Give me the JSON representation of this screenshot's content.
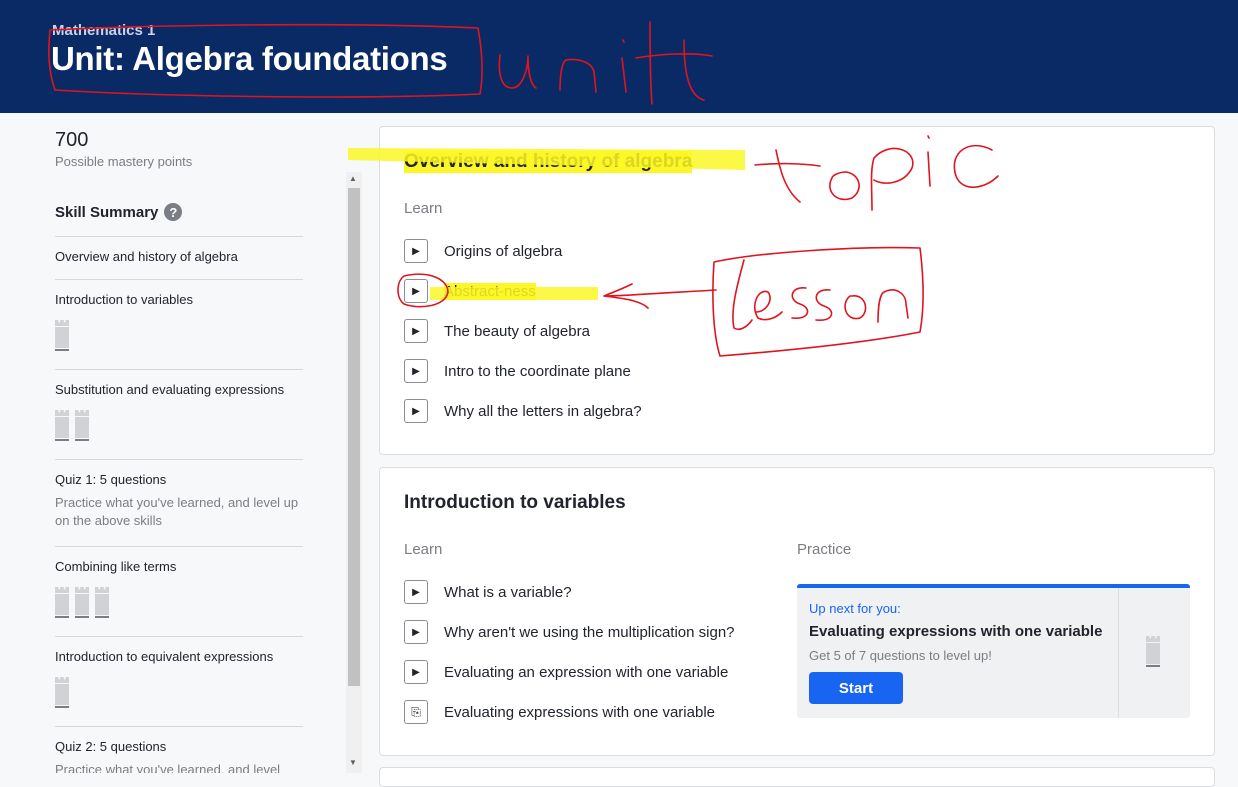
{
  "header": {
    "breadcrumb": "Mathematics 1",
    "title": "Unit: Algebra foundations"
  },
  "sidebar": {
    "points": "700",
    "points_label": "Possible mastery points",
    "skill_summary": "Skill Summary",
    "help_icon": "?",
    "items": [
      {
        "label": "Overview and history of algebra",
        "towers": 0
      },
      {
        "label": "Introduction to variables",
        "towers": 1
      },
      {
        "label": "Substitution and evaluating expressions",
        "towers": 2
      },
      {
        "label": "Quiz 1: 5 questions",
        "desc": "Practice what you've learned, and level up on the above skills"
      },
      {
        "label": "Combining like terms",
        "towers": 3
      },
      {
        "label": "Introduction to equivalent expressions",
        "towers": 1
      },
      {
        "label": "Quiz 2: 5 questions",
        "desc": "Practice what you've learned, and level"
      }
    ]
  },
  "topics": [
    {
      "title": "Overview and history of algebra",
      "learn_label": "Learn",
      "lessons": [
        "Origins of algebra",
        "Abstract-ness",
        "The beauty of algebra",
        "Intro to the coordinate plane",
        "Why all the letters in algebra?"
      ]
    },
    {
      "title": "Introduction to variables",
      "learn_label": "Learn",
      "practice_label": "Practice",
      "lessons": [
        "What is a variable?",
        "Why aren't we using the multiplication sign?",
        "Evaluating an expression with one variable",
        "Evaluating expressions with one variable"
      ],
      "up_next": {
        "label": "Up next for you:",
        "title": "Evaluating expressions with one variable",
        "subtitle": "Get 5 of 7 questions to level up!",
        "button": "Start"
      }
    }
  ],
  "icons": {
    "video": "play-icon",
    "exercise": "exercise-icon",
    "play_glyph": "▶",
    "exercise_glyph": "⎘",
    "scroll_up": "▲",
    "scroll_down": "▼"
  },
  "colors": {
    "header_bg": "#0a2a66",
    "accent": "#1865f2",
    "highlight": "#fbf726",
    "annotation": "#e0141e"
  }
}
